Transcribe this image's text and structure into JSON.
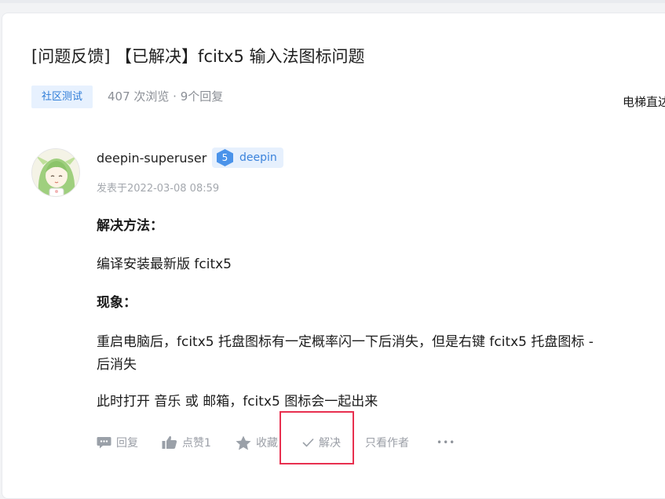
{
  "post": {
    "title": "[问题反馈] 【已解决】fcitx5 输入法图标问题",
    "tag": "社区测试",
    "stats": "407 次浏览 · 9个回复",
    "side_text": "电梯直达"
  },
  "author": {
    "name": "deepin-superuser",
    "level": "5",
    "badge": "deepin",
    "time": "发表于2022-03-08 08:59"
  },
  "content": {
    "solution_heading": "解决方法：",
    "solution_text": "编译安装最新版 fcitx5",
    "symptom_heading": "现象：",
    "symptom_line1": "重启电脑后，fcitx5 托盘图标有一定概率闪一下后消失，但是右键 fcitx5 托盘图标 -",
    "symptom_line2": "后消失",
    "symptom_line3": "此时打开 音乐 或 邮箱，fcitx5 图标会一起出来"
  },
  "actions": {
    "reply": "回复",
    "like": "点赞1",
    "favorite": "收藏",
    "solve": "解决",
    "author_only": "只看作者",
    "more": "•••"
  },
  "colors": {
    "accent": "#2f7dd8",
    "highlight_box": "#e8304f",
    "muted_text": "#9a9ea6"
  },
  "icons": [
    "chat-bubble-icon",
    "thumbs-up-icon",
    "star-icon",
    "checkmark-icon",
    "more-dots-icon",
    "level-hexagon-icon"
  ]
}
